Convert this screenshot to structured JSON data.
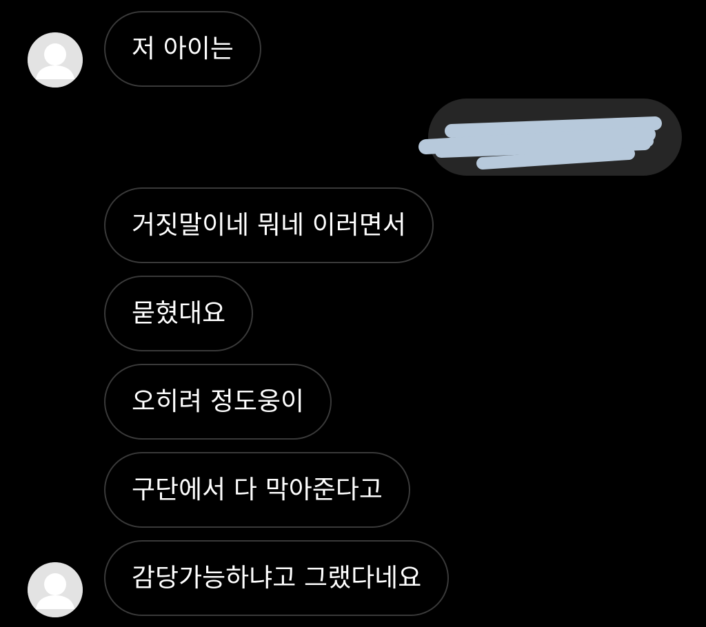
{
  "chat": {
    "messages": [
      {
        "text": "저 아이는"
      },
      {
        "text": "거짓말이네 뭐네 이러면서"
      },
      {
        "text": "묻혔대요"
      },
      {
        "text": "오히려 정도웅이"
      },
      {
        "text": "구단에서 다 막아준다고"
      },
      {
        "text": "감당가능하냐고 그랬다네요"
      }
    ],
    "sent_message": {
      "redacted": true
    },
    "colors": {
      "background": "#000000",
      "received_border": "#3a3a3a",
      "sent_bubble": "#262626",
      "redaction": "#b7c9db",
      "avatar": "#e3e3e3"
    }
  }
}
